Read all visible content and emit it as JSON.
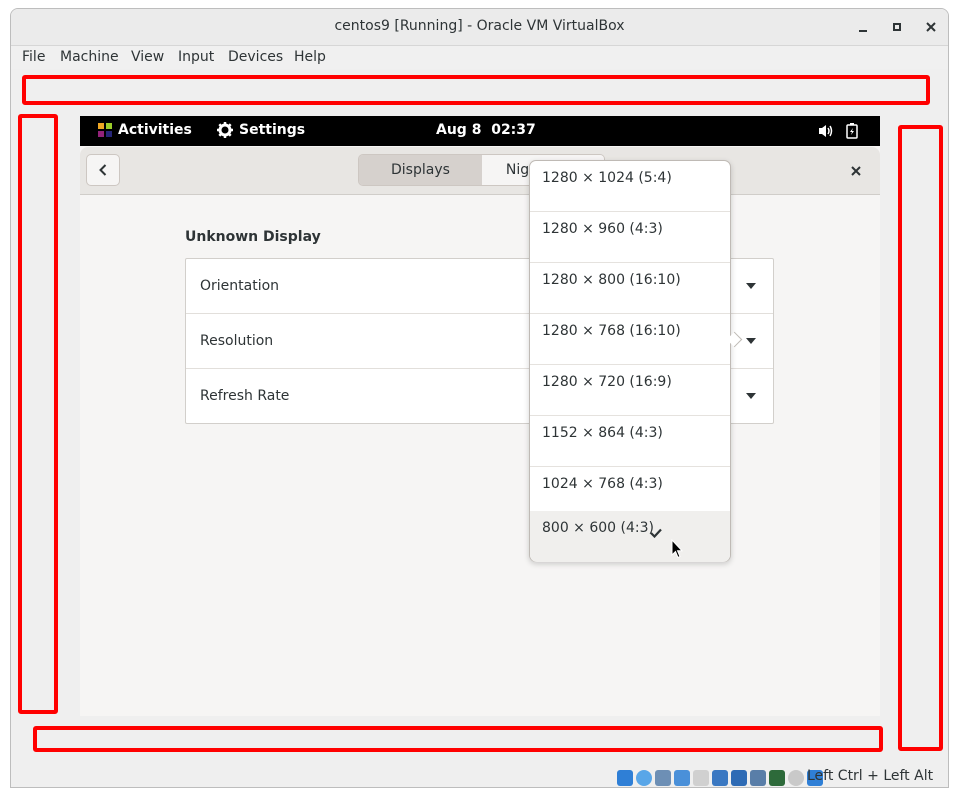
{
  "window": {
    "title": "centos9 [Running] - Oracle VM VirtualBox"
  },
  "menubar": {
    "items": [
      "File",
      "Machine",
      "View",
      "Input",
      "Devices",
      "Help"
    ]
  },
  "gnome_topbar": {
    "activities": "Activities",
    "app_menu": "Settings",
    "clock_date": "Aug 8",
    "clock_time": "02:37"
  },
  "headerbar": {
    "tabs": [
      {
        "label": "Displays",
        "active": true
      },
      {
        "label": "Night Light",
        "visible_text": "Nigh",
        "active": false
      }
    ]
  },
  "display": {
    "section_title": "Unknown Display",
    "rows": [
      {
        "label": "Orientation"
      },
      {
        "label": "Resolution"
      },
      {
        "label": "Refresh Rate"
      }
    ]
  },
  "resolution_popover": {
    "options": [
      {
        "label": "1280 × 1024 (5:4)",
        "selected": false
      },
      {
        "label": "1280 × 960 (4:3)",
        "selected": false
      },
      {
        "label": "1280 × 800 (16:10)",
        "selected": false
      },
      {
        "label": "1280 × 768 (16:10)",
        "selected": false
      },
      {
        "label": "1280 × 720 (16:9)",
        "selected": false
      },
      {
        "label": "1152 × 864 (4:3)",
        "selected": false
      },
      {
        "label": "1024 × 768 (4:3)",
        "selected": false
      },
      {
        "label": "800 × 600 (4:3)",
        "selected": true
      }
    ]
  },
  "statusbar": {
    "host_key": "Left Ctrl + Left Alt",
    "icons": [
      "harddisk-icon",
      "optical-drive-icon",
      "audio-icon",
      "network-icon",
      "usb-icon",
      "shared-folder-icon",
      "display-icon",
      "recording-icon",
      "cpu-icon",
      "mouse-integration-icon",
      "host-key-arrow-icon"
    ]
  },
  "colors": {
    "annotation_red": "#ff0000",
    "gnome_bg": "#f6f5f4",
    "topbar_bg": "#000000"
  }
}
